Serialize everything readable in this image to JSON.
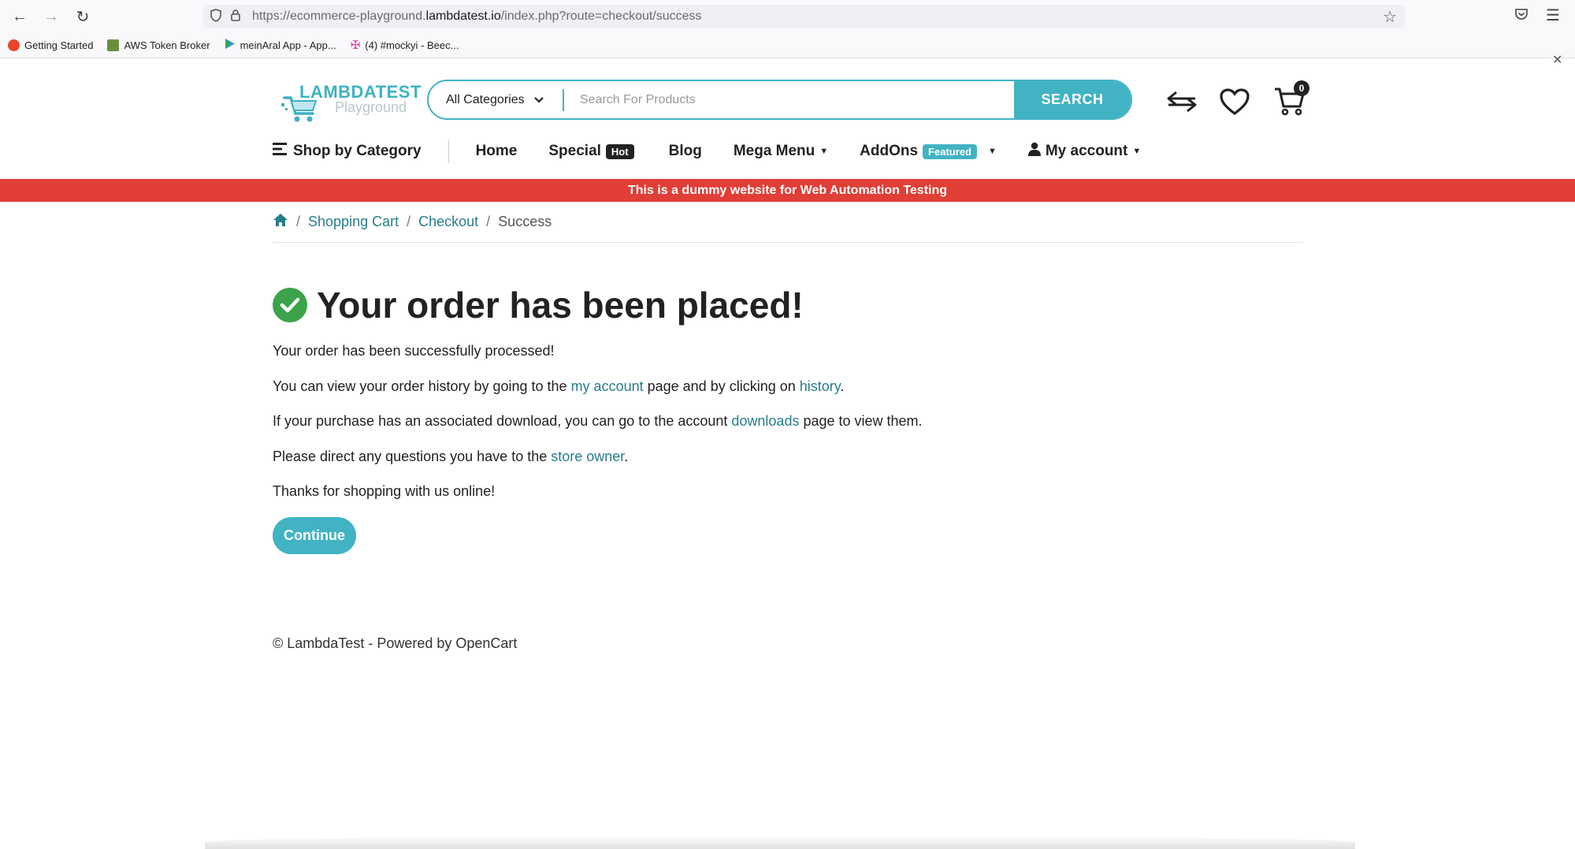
{
  "browser": {
    "url_prefix": "https://ecommerce-playground.",
    "url_domain": "lambdatest.io",
    "url_suffix": "/index.php?route=checkout/success",
    "bookmarks": [
      {
        "label": "Getting Started",
        "color": "#e8462b"
      },
      {
        "label": "AWS Token Broker",
        "color": "#6b8e3d"
      },
      {
        "label": "meinAral App - App...",
        "color": "#2f9be0"
      },
      {
        "label": "(4) #mockyi - Beec...",
        "color": "#d94fb5"
      }
    ],
    "icons": [
      "back-icon",
      "forward-icon",
      "reload-icon",
      "shield-icon",
      "lock-icon",
      "star-icon",
      "pocket-icon",
      "menu-icon",
      "close-icon"
    ]
  },
  "header": {
    "logo_title": "LAMBDATEST",
    "logo_subtitle": "Playground",
    "category_label": "All Categories",
    "search_placeholder": "Search For Products",
    "search_button": "SEARCH",
    "cart_count": "0",
    "accent": "#41b3c3"
  },
  "nav": {
    "shop_by_category": "Shop by Category",
    "home": "Home",
    "special": "Special",
    "special_badge": "Hot",
    "blog": "Blog",
    "mega_menu": "Mega Menu",
    "addons": "AddOns",
    "addons_badge": "Featured",
    "my_account": "My account"
  },
  "banner": {
    "text": "This is a dummy website for Web Automation Testing",
    "color": "#e03e36"
  },
  "breadcrumb": {
    "items": [
      "Shopping Cart",
      "Checkout",
      "Success"
    ]
  },
  "content": {
    "title": "Your order has been placed!",
    "line1": "Your order has been successfully processed!",
    "line2_pre": "You can view your order history by going to the ",
    "line2_link1": "my account",
    "line2_mid": " page and by clicking on ",
    "line2_link2": "history",
    "line2_post": ".",
    "line3_pre": "If your purchase has an associated download, you can go to the account ",
    "line3_link": "downloads",
    "line3_post": " page to view them.",
    "line4_pre": "Please direct any questions you have to the ",
    "line4_link": "store owner",
    "line4_post": ".",
    "line5": "Thanks for shopping with us online!",
    "continue_button": "Continue"
  },
  "footer": {
    "text": "© LambdaTest - Powered by OpenCart"
  }
}
